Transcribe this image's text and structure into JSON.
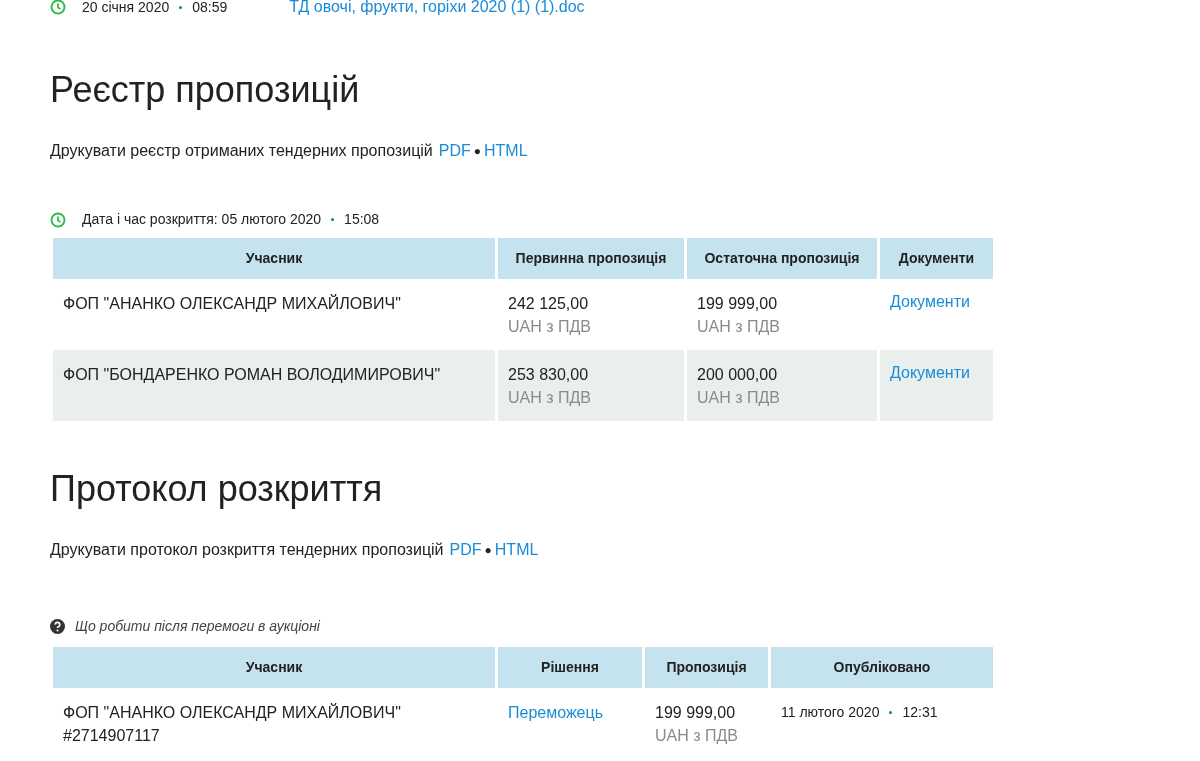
{
  "top_line": {
    "date": "20 січня 2020",
    "time": "08:59",
    "file_link": "ТД овочі, фрукти, горіхи 2020 (1) (1).doc"
  },
  "register": {
    "title": "Реєстр пропозицій",
    "print_text": "Друкувати реєстр отриманих тендерних пропозицій",
    "links": [
      "PDF",
      "HTML"
    ],
    "separator": "●",
    "opening": {
      "label": "Дата і час розкриття: 05 лютого 2020",
      "time": "15:08"
    },
    "columns": [
      "Учасник",
      "Первинна пропозиція",
      "Остаточна пропозиція",
      "Документи"
    ],
    "rows": [
      {
        "participant": "ФОП \"АНАНКО ОЛЕКСАНДР МИХАЙЛОВИЧ\"",
        "initial": "242 125,00",
        "initial_note": "UAH з ПДВ",
        "final": "199 999,00",
        "final_note": "UAH з ПДВ",
        "docs": "Документи"
      },
      {
        "participant": "ФОП \"БОНДАРЕНКО РОМАН ВОЛОДИМИРОВИЧ\"",
        "initial": "253 830,00",
        "initial_note": "UAH з ПДВ",
        "final": "200 000,00",
        "final_note": "UAH з ПДВ",
        "docs": "Документи"
      }
    ]
  },
  "protocol": {
    "title": "Протокол розкриття",
    "print_text": "Друкувати протокол розкриття тендерних пропозицій",
    "links": [
      "PDF",
      "HTML"
    ],
    "separator": "●",
    "help_link": "Що робити після перемоги в аукціоні",
    "columns": [
      "Учасник",
      "Рішення",
      "Пропозиція",
      "Опубліковано"
    ],
    "rows": [
      {
        "participant": "ФОП \"АНАНКО ОЛЕКСАНДР МИХАЙЛОВИЧ\"",
        "participant_id": "#2714907117",
        "decision": "Переможець",
        "offer": "199 999,00",
        "offer_note": "UAH з ПДВ",
        "published_date": "11 лютого 2020",
        "published_time": "12:31"
      }
    ]
  }
}
